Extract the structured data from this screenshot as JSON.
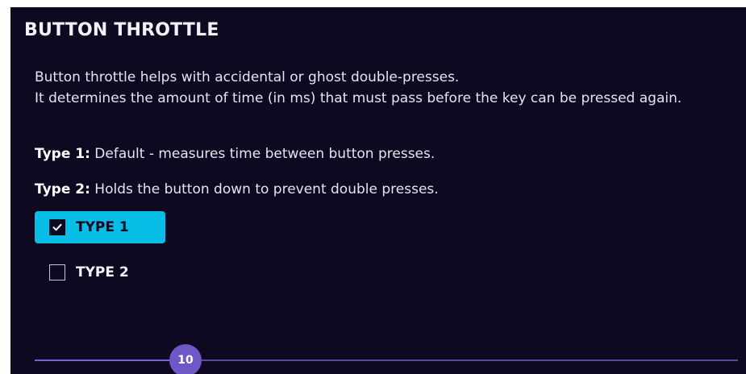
{
  "title": "BUTTON THROTTLE",
  "description": {
    "line1": "Button throttle helps with accidental or ghost double-presses.",
    "line2": "It determines the amount of time (in ms) that must pass before the key can be pressed again."
  },
  "types": {
    "type1_label": "Type 1:",
    "type1_text": " Default - measures time between button presses.",
    "type2_label": "Type 2:",
    "type2_text": " Holds the button down to prevent double presses."
  },
  "options": [
    {
      "label": "TYPE 1",
      "checked": true
    },
    {
      "label": "TYPE 2",
      "checked": false
    }
  ],
  "slider": {
    "value": "10",
    "fraction": 0.214
  },
  "colors": {
    "panel_bg": "#0e0820",
    "accent": "#08bde6",
    "slider": "#6e57c7"
  },
  "icons": {
    "check": "check-icon"
  }
}
